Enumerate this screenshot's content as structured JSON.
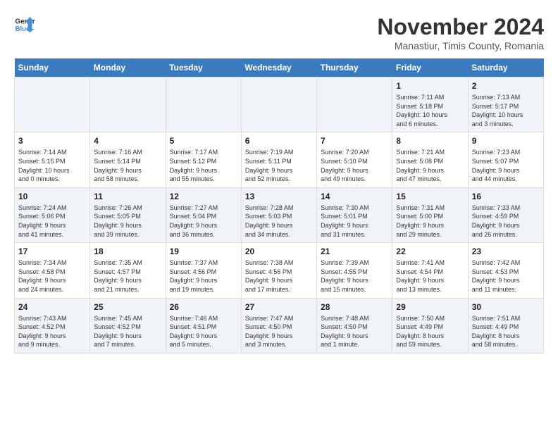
{
  "logo": {
    "line1": "General",
    "line2": "Blue"
  },
  "title": "November 2024",
  "location": "Manastiur, Timis County, Romania",
  "days_of_week": [
    "Sunday",
    "Monday",
    "Tuesday",
    "Wednesday",
    "Thursday",
    "Friday",
    "Saturday"
  ],
  "weeks": [
    [
      {
        "day": "",
        "info": ""
      },
      {
        "day": "",
        "info": ""
      },
      {
        "day": "",
        "info": ""
      },
      {
        "day": "",
        "info": ""
      },
      {
        "day": "",
        "info": ""
      },
      {
        "day": "1",
        "info": "Sunrise: 7:11 AM\nSunset: 5:18 PM\nDaylight: 10 hours\nand 6 minutes."
      },
      {
        "day": "2",
        "info": "Sunrise: 7:13 AM\nSunset: 5:17 PM\nDaylight: 10 hours\nand 3 minutes."
      }
    ],
    [
      {
        "day": "3",
        "info": "Sunrise: 7:14 AM\nSunset: 5:15 PM\nDaylight: 10 hours\nand 0 minutes."
      },
      {
        "day": "4",
        "info": "Sunrise: 7:16 AM\nSunset: 5:14 PM\nDaylight: 9 hours\nand 58 minutes."
      },
      {
        "day": "5",
        "info": "Sunrise: 7:17 AM\nSunset: 5:12 PM\nDaylight: 9 hours\nand 55 minutes."
      },
      {
        "day": "6",
        "info": "Sunrise: 7:19 AM\nSunset: 5:11 PM\nDaylight: 9 hours\nand 52 minutes."
      },
      {
        "day": "7",
        "info": "Sunrise: 7:20 AM\nSunset: 5:10 PM\nDaylight: 9 hours\nand 49 minutes."
      },
      {
        "day": "8",
        "info": "Sunrise: 7:21 AM\nSunset: 5:08 PM\nDaylight: 9 hours\nand 47 minutes."
      },
      {
        "day": "9",
        "info": "Sunrise: 7:23 AM\nSunset: 5:07 PM\nDaylight: 9 hours\nand 44 minutes."
      }
    ],
    [
      {
        "day": "10",
        "info": "Sunrise: 7:24 AM\nSunset: 5:06 PM\nDaylight: 9 hours\nand 41 minutes."
      },
      {
        "day": "11",
        "info": "Sunrise: 7:26 AM\nSunset: 5:05 PM\nDaylight: 9 hours\nand 39 minutes."
      },
      {
        "day": "12",
        "info": "Sunrise: 7:27 AM\nSunset: 5:04 PM\nDaylight: 9 hours\nand 36 minutes."
      },
      {
        "day": "13",
        "info": "Sunrise: 7:28 AM\nSunset: 5:03 PM\nDaylight: 9 hours\nand 34 minutes."
      },
      {
        "day": "14",
        "info": "Sunrise: 7:30 AM\nSunset: 5:01 PM\nDaylight: 9 hours\nand 31 minutes."
      },
      {
        "day": "15",
        "info": "Sunrise: 7:31 AM\nSunset: 5:00 PM\nDaylight: 9 hours\nand 29 minutes."
      },
      {
        "day": "16",
        "info": "Sunrise: 7:33 AM\nSunset: 4:59 PM\nDaylight: 9 hours\nand 26 minutes."
      }
    ],
    [
      {
        "day": "17",
        "info": "Sunrise: 7:34 AM\nSunset: 4:58 PM\nDaylight: 9 hours\nand 24 minutes."
      },
      {
        "day": "18",
        "info": "Sunrise: 7:35 AM\nSunset: 4:57 PM\nDaylight: 9 hours\nand 21 minutes."
      },
      {
        "day": "19",
        "info": "Sunrise: 7:37 AM\nSunset: 4:56 PM\nDaylight: 9 hours\nand 19 minutes."
      },
      {
        "day": "20",
        "info": "Sunrise: 7:38 AM\nSunset: 4:56 PM\nDaylight: 9 hours\nand 17 minutes."
      },
      {
        "day": "21",
        "info": "Sunrise: 7:39 AM\nSunset: 4:55 PM\nDaylight: 9 hours\nand 15 minutes."
      },
      {
        "day": "22",
        "info": "Sunrise: 7:41 AM\nSunset: 4:54 PM\nDaylight: 9 hours\nand 13 minutes."
      },
      {
        "day": "23",
        "info": "Sunrise: 7:42 AM\nSunset: 4:53 PM\nDaylight: 9 hours\nand 11 minutes."
      }
    ],
    [
      {
        "day": "24",
        "info": "Sunrise: 7:43 AM\nSunset: 4:52 PM\nDaylight: 9 hours\nand 9 minutes."
      },
      {
        "day": "25",
        "info": "Sunrise: 7:45 AM\nSunset: 4:52 PM\nDaylight: 9 hours\nand 7 minutes."
      },
      {
        "day": "26",
        "info": "Sunrise: 7:46 AM\nSunset: 4:51 PM\nDaylight: 9 hours\nand 5 minutes."
      },
      {
        "day": "27",
        "info": "Sunrise: 7:47 AM\nSunset: 4:50 PM\nDaylight: 9 hours\nand 3 minutes."
      },
      {
        "day": "28",
        "info": "Sunrise: 7:48 AM\nSunset: 4:50 PM\nDaylight: 9 hours\nand 1 minute."
      },
      {
        "day": "29",
        "info": "Sunrise: 7:50 AM\nSunset: 4:49 PM\nDaylight: 8 hours\nand 59 minutes."
      },
      {
        "day": "30",
        "info": "Sunrise: 7:51 AM\nSunset: 4:49 PM\nDaylight: 8 hours\nand 58 minutes."
      }
    ]
  ]
}
